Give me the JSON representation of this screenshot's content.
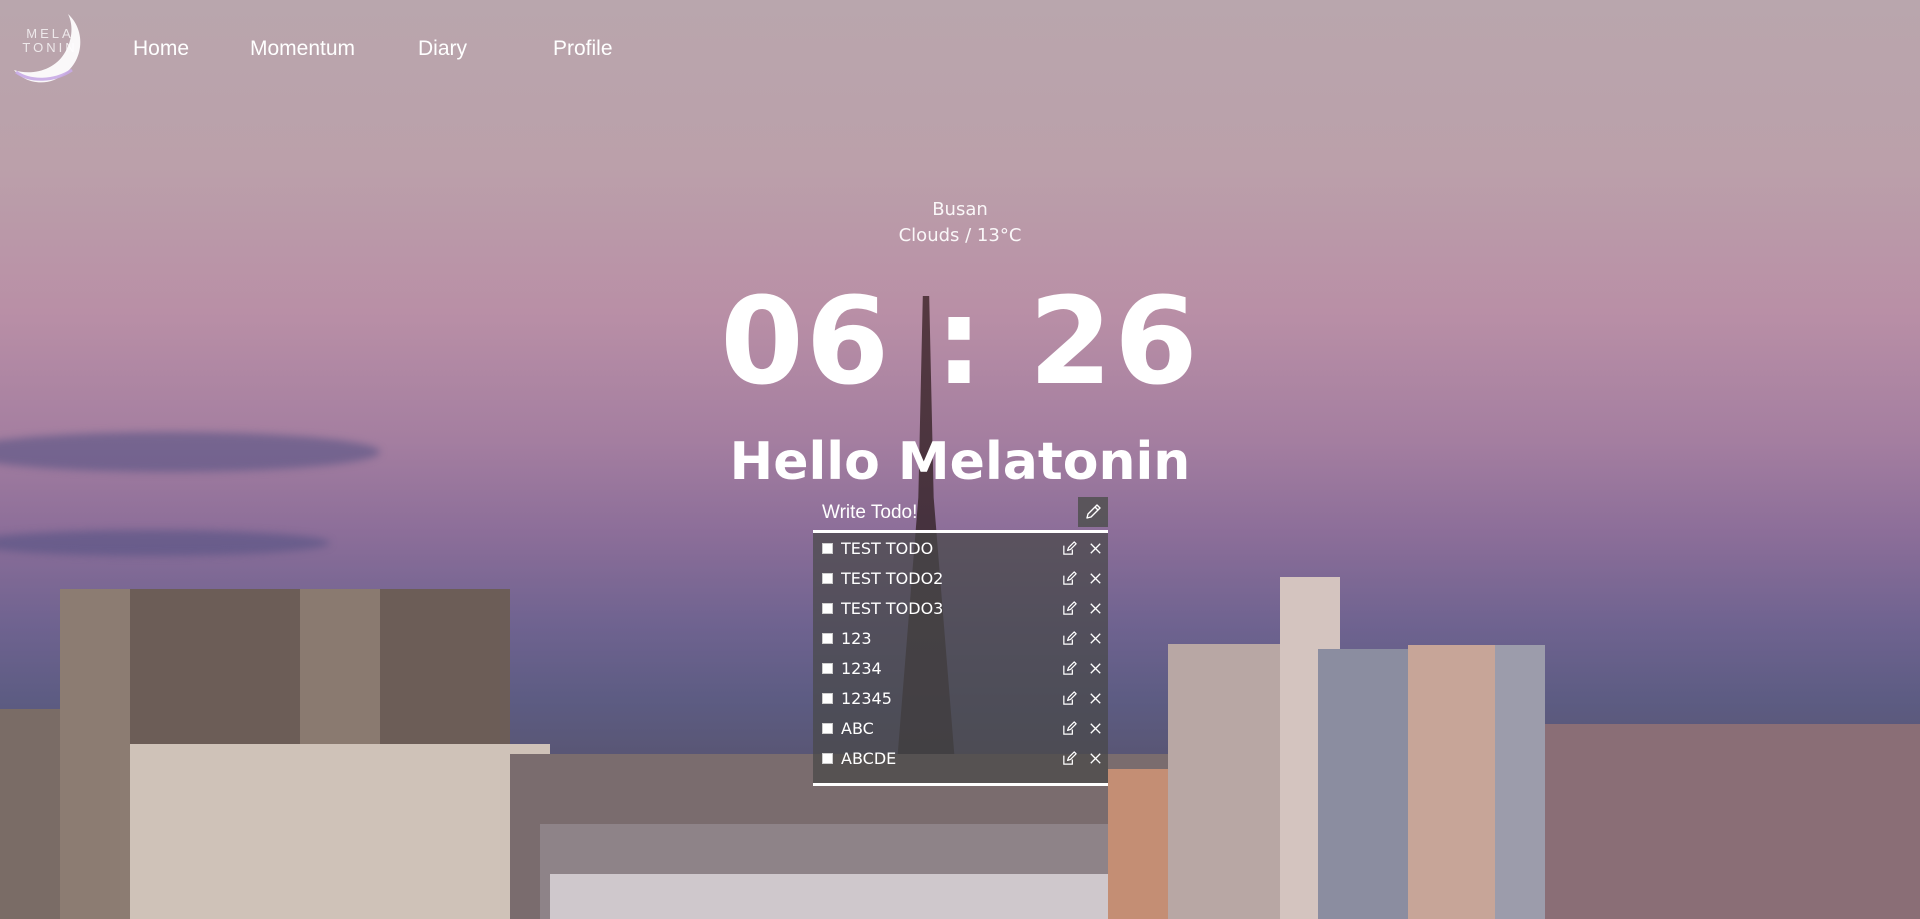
{
  "header": {
    "logo_text": "MELA TONIN",
    "nav": [
      {
        "label": "Home"
      },
      {
        "label": "Momentum"
      },
      {
        "label": "Diary"
      },
      {
        "label": "Profile"
      }
    ]
  },
  "weather": {
    "city": "Busan",
    "condition": "Clouds / 13°C"
  },
  "clock": {
    "time": "06 : 26"
  },
  "greeting": "Hello Melatonin",
  "todo": {
    "placeholder": "Write Todo!",
    "submit_icon": "pencil-icon",
    "items": [
      {
        "text": "TEST TODO"
      },
      {
        "text": "TEST TODO2"
      },
      {
        "text": "TEST TODO3"
      },
      {
        "text": "123"
      },
      {
        "text": "1234"
      },
      {
        "text": "12345"
      },
      {
        "text": "ABC"
      },
      {
        "text": "ABCDE"
      }
    ],
    "edit_icon": "edit-icon",
    "delete_icon": "close-icon"
  },
  "colors": {
    "text": "#ffffff",
    "todo_panel": "#484848"
  }
}
